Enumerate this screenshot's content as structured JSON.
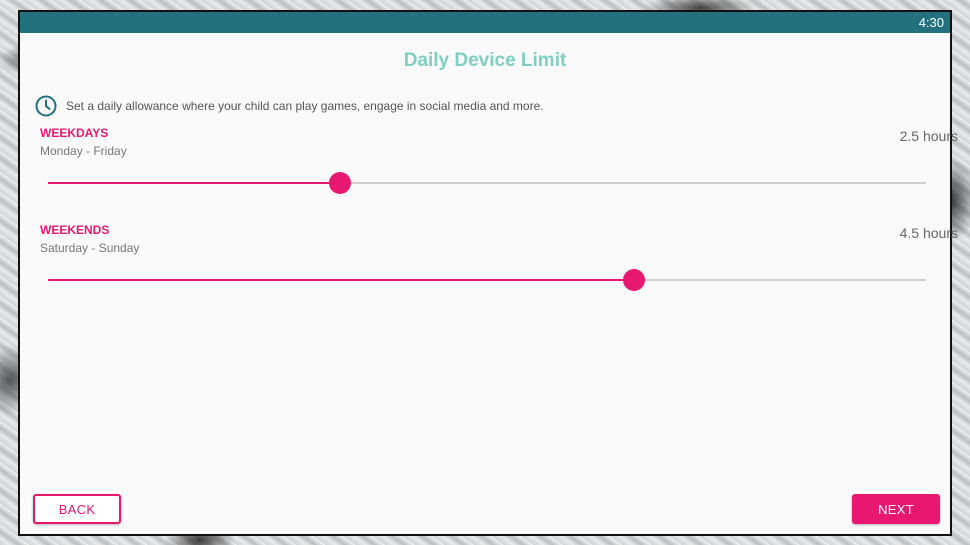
{
  "status_bar": {
    "time": "4:30",
    "color": "#23707f"
  },
  "header": {
    "title": "Daily Device Limit",
    "title_color": "#7fcfc4"
  },
  "intro": {
    "icon": "clock-icon",
    "text": "Set a daily allowance where your child can play games, engage in social media and more."
  },
  "accent_color": "#e8176f",
  "limits": [
    {
      "title": "WEEKDAYS",
      "subtitle": "Monday - Friday",
      "value_label": "2.5 hours",
      "fraction": 0.333
    },
    {
      "title": "WEEKENDS",
      "subtitle": "Saturday - Sunday",
      "value_label": "4.5 hours",
      "fraction": 0.667
    }
  ],
  "buttons": {
    "back": "BACK",
    "next": "NEXT"
  }
}
